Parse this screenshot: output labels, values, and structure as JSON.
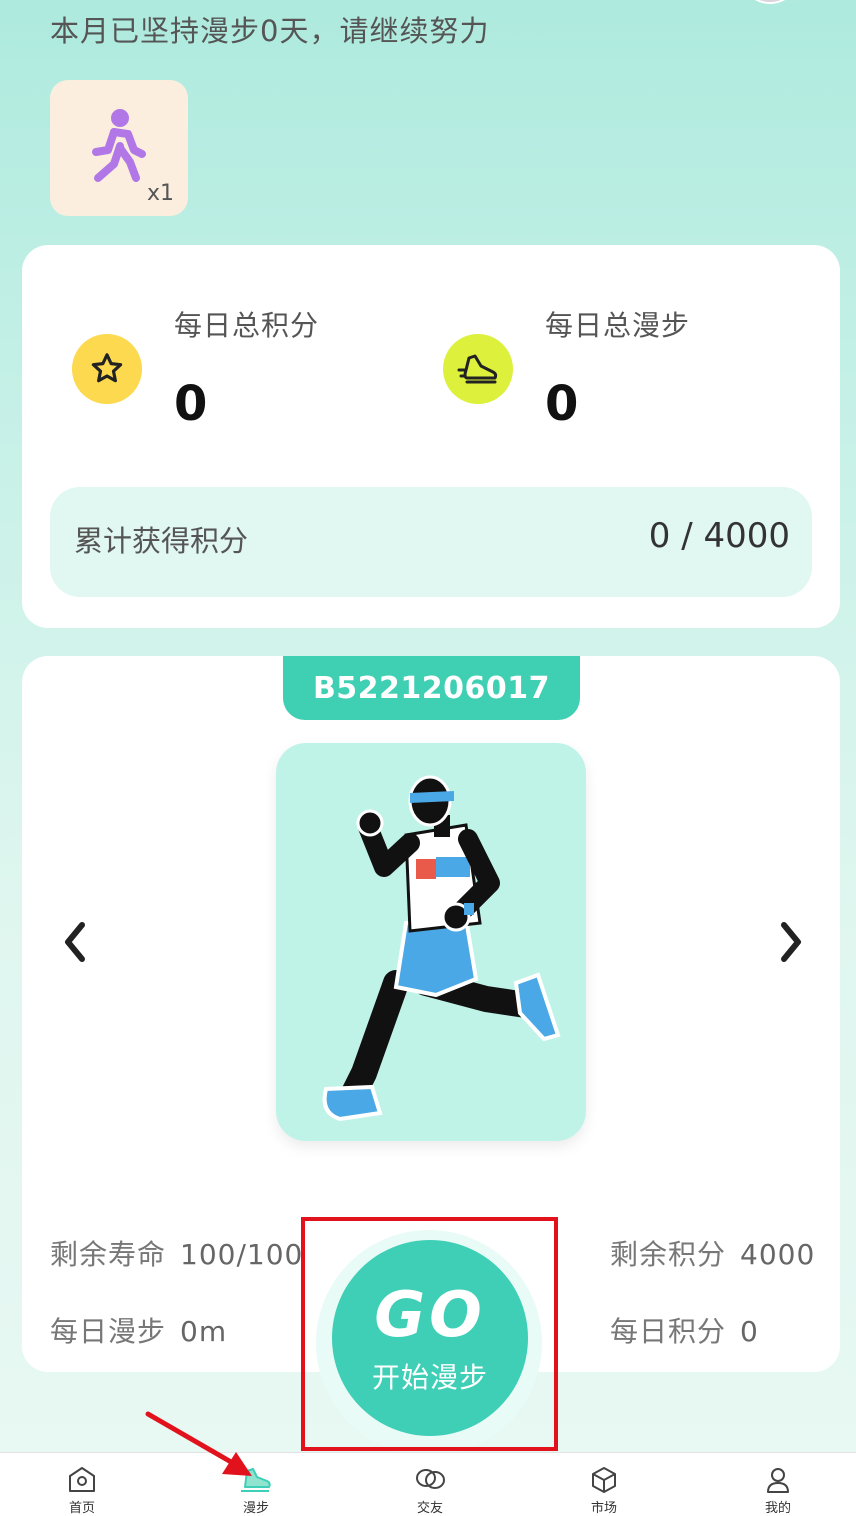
{
  "header": {
    "message": "本月已坚持漫步0天，请继续努力"
  },
  "badge": {
    "icon": "walking-person-icon",
    "count": "x1"
  },
  "stats": {
    "points_label": "每日总积分",
    "points_value": "0",
    "walk_label": "每日总漫步",
    "walk_value": "0",
    "total_label": "累计获得积分",
    "total_value": "0 / 4000"
  },
  "walker": {
    "id": "B5221206017",
    "life_label": "剩余寿命",
    "life_value": "100/100",
    "daily_walk_label": "每日漫步",
    "daily_walk_value": "0m",
    "remaining_points_label": "剩余积分",
    "remaining_points_value": "4000",
    "daily_points_label": "每日积分",
    "daily_points_value": "0"
  },
  "go_button": {
    "text": "GO",
    "label": "开始漫步"
  },
  "nav": {
    "items": [
      {
        "label": "首页",
        "icon": "home-icon"
      },
      {
        "label": "漫步",
        "icon": "shoe-icon"
      },
      {
        "label": "交友",
        "icon": "chat-icon"
      },
      {
        "label": "市场",
        "icon": "box-icon"
      },
      {
        "label": "我的",
        "icon": "user-icon"
      }
    ]
  },
  "colors": {
    "accent": "#3ecfb6",
    "highlight": "#e1121c",
    "star": "#fcd94e",
    "shoe": "#dcf03c"
  }
}
